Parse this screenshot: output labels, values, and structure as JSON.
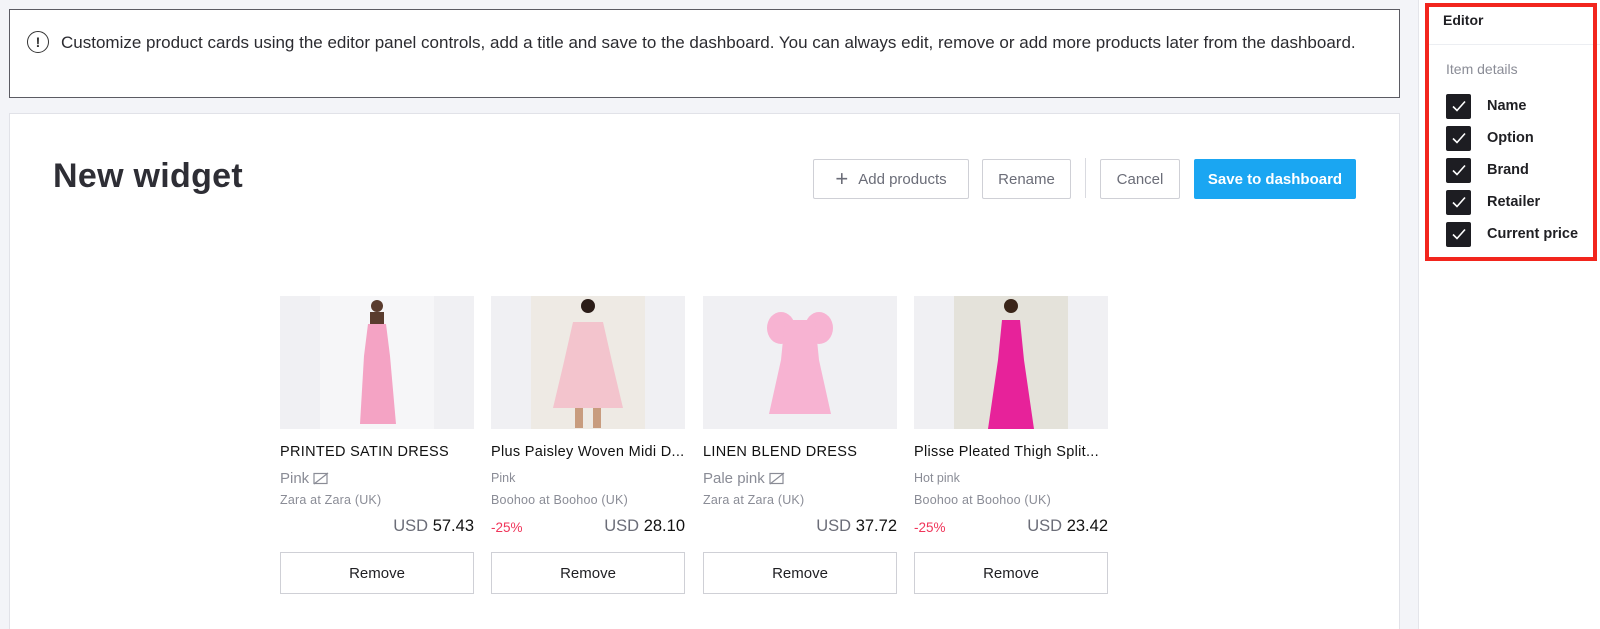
{
  "banner": {
    "message": "Customize product cards using the editor panel controls, add a title and save to the dashboard. You can always edit, remove or add more products later from the dashboard."
  },
  "widget": {
    "title": "New widget",
    "add_products_label": "Add products",
    "rename_label": "Rename",
    "cancel_label": "Cancel",
    "save_label": "Save to dashboard"
  },
  "colors": {
    "accent": "#1aa6f2",
    "discount": "#f0355a",
    "highlight": "#f2251d"
  },
  "products": [
    {
      "name": "PRINTED SATIN DRESS",
      "option": "Pink",
      "option_hidden": true,
      "retailer": "Zara at Zara (UK)",
      "discount": "",
      "currency": "USD",
      "price": "57.43",
      "remove_label": "Remove",
      "dress_color": "#f4a3c4"
    },
    {
      "name": "Plus Paisley Woven Midi D...",
      "option": "Pink",
      "option_hidden": false,
      "retailer": "Boohoo at Boohoo (UK)",
      "discount": "-25%",
      "currency": "USD",
      "price": "28.10",
      "remove_label": "Remove",
      "dress_color": "#f3c4cd"
    },
    {
      "name": "LINEN BLEND DRESS",
      "option": "Pale pink",
      "option_hidden": true,
      "retailer": "Zara at Zara (UK)",
      "discount": "",
      "currency": "USD",
      "price": "37.72",
      "remove_label": "Remove",
      "dress_color": "#f7b3d2"
    },
    {
      "name": "Plisse Pleated Thigh Split...",
      "option": "Hot pink",
      "option_hidden": false,
      "retailer": "Boohoo at Boohoo (UK)",
      "discount": "-25%",
      "currency": "USD",
      "price": "23.42",
      "remove_label": "Remove",
      "dress_color": "#e7229a"
    }
  ],
  "editor": {
    "title": "Editor",
    "section": "Item details",
    "options": [
      {
        "label": "Name",
        "checked": true
      },
      {
        "label": "Option",
        "checked": true
      },
      {
        "label": "Brand",
        "checked": true
      },
      {
        "label": "Retailer",
        "checked": true
      },
      {
        "label": "Current price",
        "checked": true
      }
    ]
  }
}
